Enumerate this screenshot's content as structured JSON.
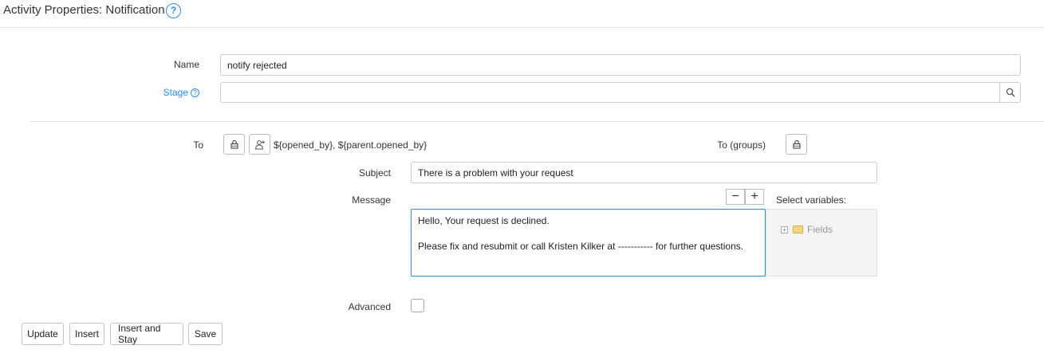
{
  "header": {
    "title": "Activity Properties: Notification",
    "help_icon": "question-circle-icon"
  },
  "form": {
    "name_label": "Name",
    "name_value": "notify rejected",
    "stage_label": "Stage",
    "stage_value": "",
    "stage_search_icon": "search-icon"
  },
  "recipients": {
    "to_label": "To",
    "to_value": "${opened_by}, ${parent.opened_by}",
    "to_groups_label": "To (groups)",
    "lock_icon": "lock-icon",
    "user_add_icon": "user-add-icon"
  },
  "subject": {
    "label": "Subject",
    "value": "There is a problem with your request"
  },
  "message": {
    "label": "Message",
    "line1": "Hello, Your request is declined.",
    "line2": "Please fix and resubmit or call Kristen Kilker at ----------- for further questions.",
    "minus_label": "−",
    "plus_label": "+"
  },
  "variables": {
    "label": "Select variables:",
    "tree_item": "Fields"
  },
  "advanced": {
    "label": "Advanced",
    "checked": false
  },
  "buttons": {
    "update": "Update",
    "insert": "Insert",
    "insert_and_stay": "Insert and Stay",
    "save": "Save"
  },
  "colors": {
    "accent": "#278efc",
    "border": "#cccccc"
  }
}
